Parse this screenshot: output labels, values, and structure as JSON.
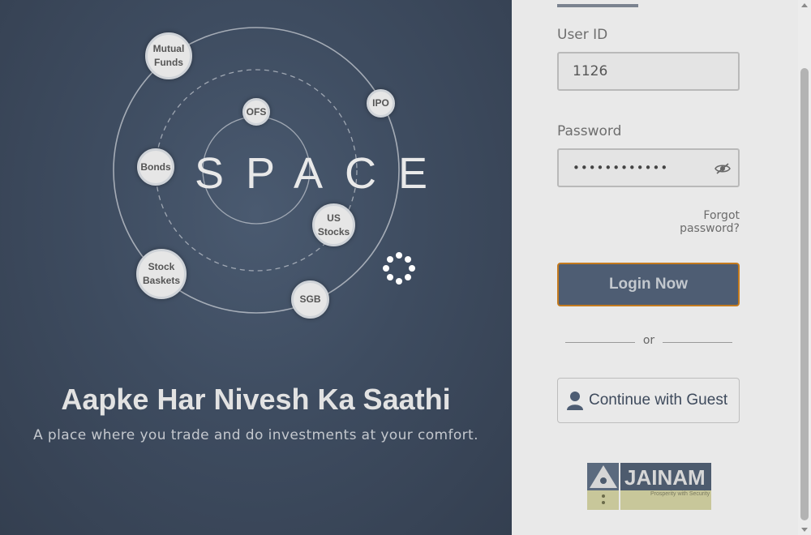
{
  "brand_diagram": {
    "center_word": "SPACE",
    "nodes": {
      "mutual_funds": "Mutual\nFunds",
      "ipo": "IPO",
      "ofs": "OFS",
      "bonds": "Bonds",
      "us_stocks": "US\nStocks",
      "stock_baskets": "Stock\nBaskets",
      "sgb": "SGB"
    }
  },
  "hero": {
    "tagline": "Aapke Har Nivesh Ka Saathi",
    "subtagline": "A place where you trade and do investments at your comfort."
  },
  "login_form": {
    "user_id_label": "User ID",
    "user_id_value": "1126",
    "password_label": "Password",
    "password_masked": "••••••••••••",
    "forgot_password": "Forgot password?",
    "login_button": "Login Now",
    "divider_text": "or",
    "guest_button": "Continue with Guest"
  },
  "logo": {
    "name": "JAINAM",
    "tagline": "Prosperity with Security"
  },
  "icons": {
    "password_visibility": "eye-slash-icon",
    "guest": "user-icon",
    "loading": "spinner-icon"
  },
  "colors": {
    "left_panel": "#3e4c60",
    "login_button_bg": "#4e5d73",
    "login_button_border": "#c47a1e",
    "right_panel": "#e9e9e9"
  }
}
